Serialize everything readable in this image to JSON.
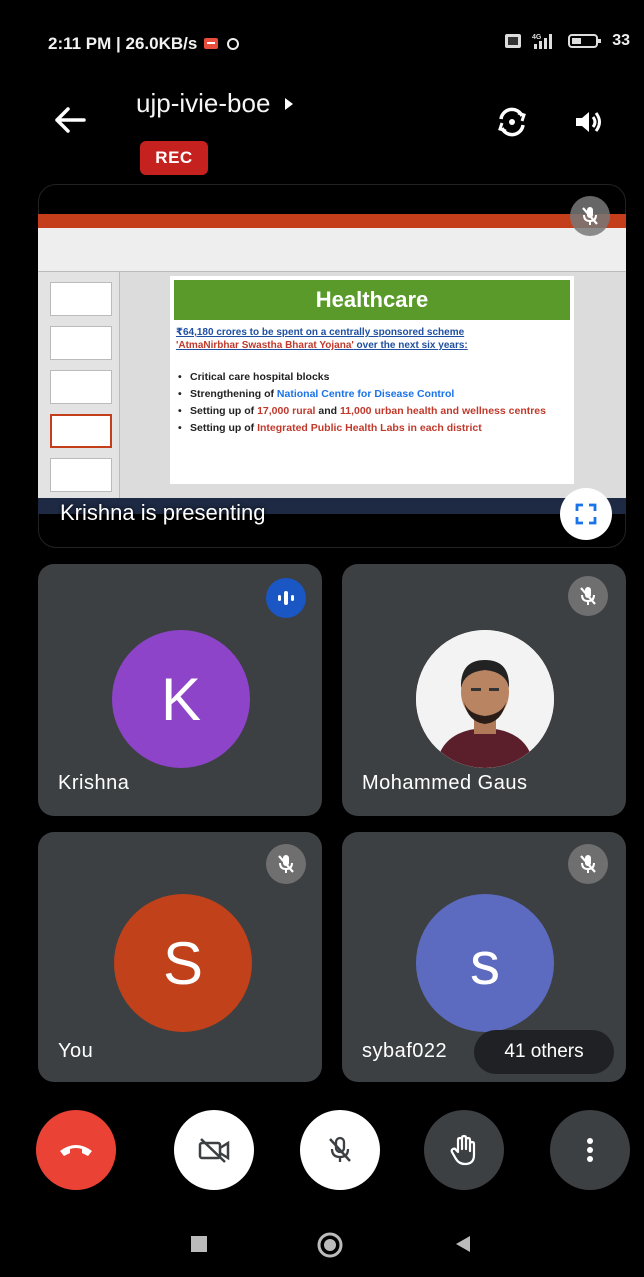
{
  "status_bar": {
    "time_speed": "2:11 PM | 26.0KB/s",
    "battery": "33"
  },
  "header": {
    "meeting_code": "ujp-ivie-boe",
    "rec_label": "REC"
  },
  "presentation": {
    "presenter_label": "Krishna is presenting",
    "slide": {
      "title": "Healthcare",
      "subtitle_line1": "₹64,180 crores to be spent on a centrally sponsored scheme",
      "subtitle_line2_red": "'AtmaNirbhar Swastha Bharat Yojana'",
      "subtitle_line2_rest": " over the next six years:",
      "bullets": [
        {
          "text": "Critical care hospital blocks"
        },
        {
          "pre": "Strengthening of ",
          "highlight": "National Centre for Disease Control",
          "post": ""
        },
        {
          "pre": "Setting up of ",
          "highlight": "17,000 rural",
          "mid": " and ",
          "highlight2": "11,000 urban health and wellness centres"
        },
        {
          "pre": "Setting up of ",
          "highlight": "Integrated Public Health Labs in each district"
        }
      ]
    }
  },
  "participants": [
    {
      "name": "Krishna",
      "initial": "K",
      "color": "#8e44c9",
      "status": "speaking"
    },
    {
      "name": "Mohammed Gaus",
      "initial": "",
      "color": "#ffffff",
      "status": "muted"
    },
    {
      "name": "You",
      "initial": "S",
      "color": "#c0411a",
      "status": "muted"
    },
    {
      "name": "sybaf022",
      "initial": "s",
      "color": "#5c6bc0",
      "status": "muted"
    }
  ],
  "others_label": "41 others",
  "colors": {
    "end_call": "#ea4335",
    "tile_bg": "#3c4043",
    "rec": "#c5221f"
  },
  "icons": {
    "back": "arrow-left-icon",
    "switch_camera": "switch-camera-icon",
    "speaker": "speaker-icon",
    "fullscreen": "fullscreen-icon",
    "end_call": "phone-hangup-icon",
    "camera_off": "camera-off-icon",
    "mic_off": "mic-off-icon",
    "raise_hand": "hand-icon",
    "more": "more-vert-icon"
  }
}
